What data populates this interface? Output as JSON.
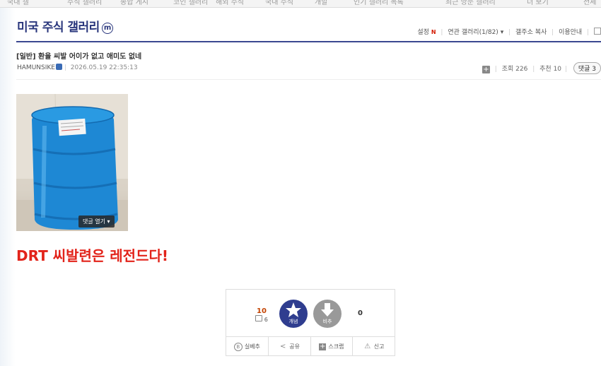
{
  "top_nav": {
    "items": [
      "국내 갤",
      "주식 갤러리",
      "종합 게시",
      "코인 갤러리",
      "해외 주식",
      "국내 주식",
      "개발",
      "인기 갤러리 목록",
      "최근 방문 갤러리",
      "더 보기",
      "전체"
    ]
  },
  "gallery": {
    "title": "미국 주식 갤러리",
    "badge": "m",
    "menu": {
      "settings": "설정",
      "new_mark": "N",
      "related": "연관 갤러리(1/82)",
      "copy_address": "갤주소 복사",
      "guide": "이용안내"
    }
  },
  "post": {
    "category": "[일반]",
    "title": "환율 씨발 어이가 없고 애미도 없네",
    "author": "HAMUNSIKE",
    "date": "2026.05.19 22:35:13",
    "views_label": "조회",
    "views": "226",
    "recommend_label": "추천",
    "recommend": "10",
    "comments_label": "댓글",
    "comments": "3",
    "open_comments_label": "댓글 열기",
    "headline": "DRT 씨발련은 레전드다!"
  },
  "vote": {
    "up_count": "10",
    "fixed_count": "6",
    "up_label": "개념",
    "down_label": "비추",
    "down_count": "0"
  },
  "actions": {
    "best": "실베추",
    "share": "공유",
    "scrap": "스크랩",
    "report": "신고"
  },
  "colors": {
    "gallery_title": "#29367c",
    "headline": "#e2231a",
    "up_button": "#2f3d8f",
    "down_button": "#999999"
  }
}
